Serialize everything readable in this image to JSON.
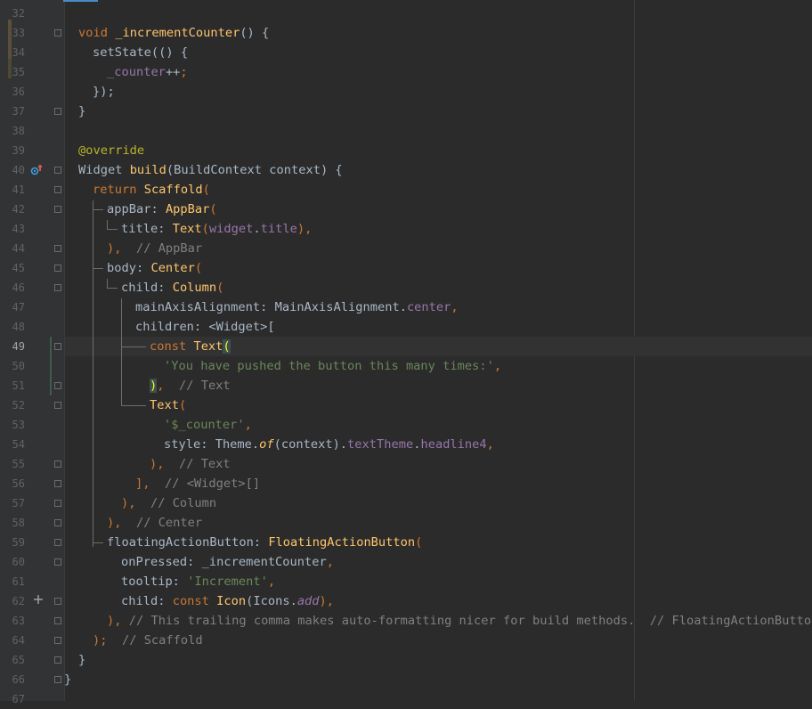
{
  "editor": {
    "line_numbers": [
      "32",
      "33",
      "34",
      "35",
      "36",
      "37",
      "38",
      "39",
      "40",
      "41",
      "42",
      "43",
      "44",
      "45",
      "46",
      "47",
      "48",
      "49",
      "50",
      "51",
      "52",
      "53",
      "54",
      "55",
      "56",
      "57",
      "58",
      "59",
      "60",
      "61",
      "62",
      "63",
      "64",
      "65",
      "66",
      "67"
    ],
    "current_line": "49",
    "gutter_icons": {
      "override": "override-marker-icon",
      "add": "plus-icon"
    },
    "code": {
      "l33": {
        "kw": "void",
        "fn": "_incrementCounter",
        "rest": "() {"
      },
      "l34": {
        "text": "setState(() {"
      },
      "l35": {
        "field": "_counter",
        "op": "++",
        "semi": ";"
      },
      "l36": {
        "text": "});"
      },
      "l37": {
        "text": "}"
      },
      "l39": {
        "ann": "@override"
      },
      "l40": {
        "a": "Widget ",
        "fn": "build",
        "b": "(BuildContext context) {"
      },
      "l41": {
        "kw": "return",
        "cls": "Scaffold",
        "paren": "("
      },
      "l42": {
        "name": "appBar:",
        "cls": "AppBar",
        "paren": "("
      },
      "l43": {
        "name": "title:",
        "cls": "Text",
        "p1": "(",
        "obj": "widget",
        "dot": ".",
        "prop": "title",
        "p2": "),"
      },
      "l44": {
        "close": "),",
        "cmt": "// AppBar"
      },
      "l45": {
        "name": "body:",
        "cls": "Center",
        "paren": "("
      },
      "l46": {
        "name": "child:",
        "cls": "Column",
        "paren": "("
      },
      "l47": {
        "name": "mainAxisAlignment:",
        "type": "MainAxisAlignment",
        "dot": ".",
        "prop": "center",
        "comma": ","
      },
      "l48": {
        "text": "children: <Widget>["
      },
      "l49": {
        "kw": "const",
        "cls": "Text",
        "paren": "("
      },
      "l50": {
        "str": "'You have pushed the button this many times:'",
        "comma": ","
      },
      "l51": {
        "paren": ")",
        "comma": ",",
        "cmt": "// Text"
      },
      "l52": {
        "cls": "Text",
        "paren": "("
      },
      "l53": {
        "str": "'$_counter'",
        "comma": ","
      },
      "l54": {
        "name": "style:",
        "a": "Theme.",
        "fn": "of",
        "b": "(context).",
        "p1": "textTheme",
        "dot": ".",
        "p2": "headline4",
        "comma": ","
      },
      "l55": {
        "close": "),",
        "cmt": "// Text"
      },
      "l56": {
        "close": "],",
        "cmt": "// <Widget>[]"
      },
      "l57": {
        "close": "),",
        "cmt": "// Column"
      },
      "l58": {
        "close": "),",
        "cmt": "// Center"
      },
      "l59": {
        "name": "floatingActionButton:",
        "cls": "FloatingActionButton",
        "paren": "("
      },
      "l60": {
        "name": "onPressed:",
        "val": "_incrementCounter",
        "comma": ","
      },
      "l61": {
        "name": "tooltip:",
        "str": "'Increment'",
        "comma": ","
      },
      "l62": {
        "name": "child:",
        "kw": "const",
        "cls": "Icon",
        "a": "(Icons.",
        "prop": "add",
        "b": "),"
      },
      "l63": {
        "close": "),",
        "cmt": "// This trailing comma makes auto-formatting nicer for build methods.  // FloatingActionButton"
      },
      "l64": {
        "close": ");",
        "cmt": "// Scaffold"
      },
      "l65": {
        "text": "}"
      },
      "l66": {
        "text": "}"
      }
    }
  }
}
